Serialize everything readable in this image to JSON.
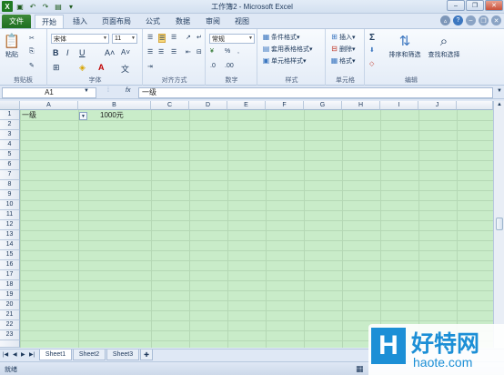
{
  "window": {
    "title": "工作簿2 - Microsoft Excel"
  },
  "tabs": [
    "文件",
    "开始",
    "插入",
    "页面布局",
    "公式",
    "数据",
    "审阅",
    "视图"
  ],
  "ribbon": {
    "clipboard": {
      "label": "剪贴板",
      "paste": "粘贴"
    },
    "font": {
      "label": "字体",
      "font_name": "宋体",
      "font_size": "11"
    },
    "alignment": {
      "label": "对齐方式"
    },
    "number": {
      "label": "数字",
      "format": "常规"
    },
    "styles": {
      "label": "样式",
      "conditional": "条件格式",
      "table": "套用表格格式",
      "cell": "单元格样式"
    },
    "cells": {
      "label": "单元格",
      "insert": "插入",
      "delete": "删除",
      "format": "格式"
    },
    "editing": {
      "label": "编辑",
      "sort": "排序和筛选",
      "find": "查找和选择"
    }
  },
  "formula_bar": {
    "name_box": "A1",
    "fx": "fx",
    "content": "一级"
  },
  "columns": [
    "A",
    "B",
    "C",
    "D",
    "E",
    "F",
    "G",
    "H",
    "I",
    "J"
  ],
  "rows": [
    "1",
    "2",
    "3",
    "4",
    "5",
    "6",
    "7",
    "8",
    "9",
    "10",
    "11",
    "12",
    "13",
    "14",
    "15",
    "16",
    "17",
    "18",
    "19",
    "20",
    "21",
    "22",
    "23"
  ],
  "cells": {
    "A1": "一级",
    "B1": "1000元"
  },
  "sheets": [
    "Sheet1",
    "Sheet2",
    "Sheet3"
  ],
  "status": {
    "ready": "就绪"
  },
  "watermark": {
    "logo": "H",
    "name": "好特网",
    "url": "haote.com"
  },
  "colors": {
    "file_tab": "#2a7b2c",
    "grid_bg": "#c9ecc9",
    "accent": "#1c8fd6"
  }
}
